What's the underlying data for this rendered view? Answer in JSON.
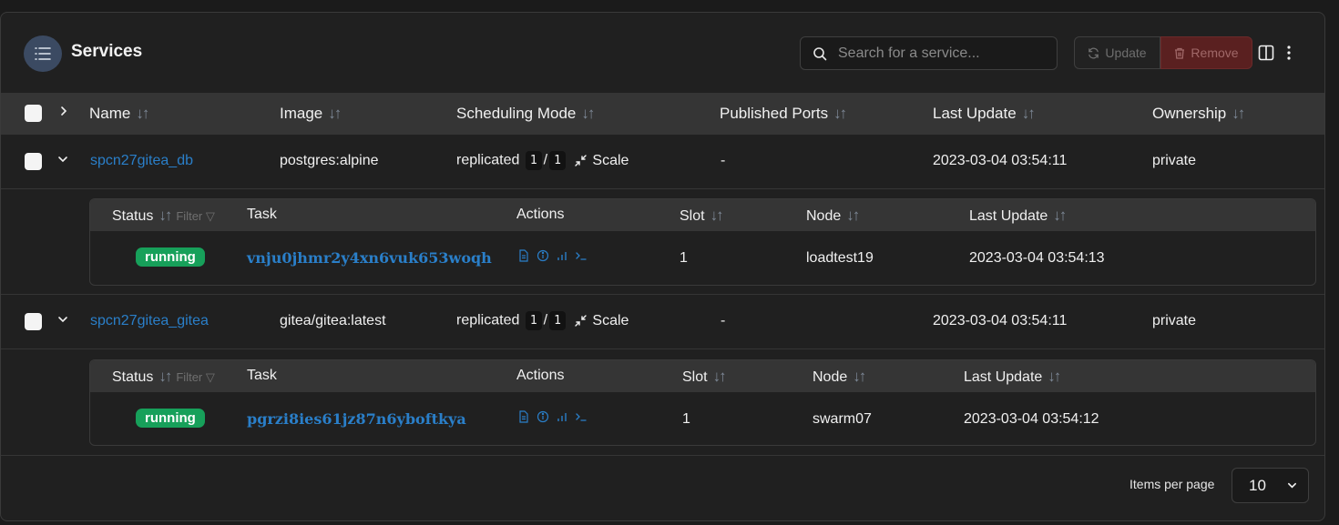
{
  "header": {
    "title": "Services",
    "search_placeholder": "Search for a service...",
    "update_label": "Update",
    "remove_label": "Remove"
  },
  "columns": {
    "name": "Name",
    "image": "Image",
    "scheduling": "Scheduling Mode",
    "ports": "Published Ports",
    "last_update": "Last Update",
    "ownership": "Ownership"
  },
  "services": [
    {
      "name": "spcn27gitea_db",
      "image": "postgres:alpine",
      "mode": "replicated",
      "running": "1",
      "sep": "/",
      "desired": "1",
      "scale_label": "Scale",
      "ports": "-",
      "last_update": "2023-03-04 03:54:11",
      "ownership": "private",
      "tasks_header": {
        "status": "Status",
        "filter": "Filter",
        "task": "Task",
        "actions": "Actions",
        "slot": "Slot",
        "node": "Node",
        "last_update": "Last Update"
      },
      "task": {
        "status": "running",
        "id": "vnju0jhmr2y4xn6vuk653woqh",
        "slot": "1",
        "node": "loadtest19",
        "last_update": "2023-03-04 03:54:13"
      }
    },
    {
      "name": "spcn27gitea_gitea",
      "image": "gitea/gitea:latest",
      "mode": "replicated",
      "running": "1",
      "sep": "/",
      "desired": "1",
      "scale_label": "Scale",
      "ports": "-",
      "last_update": "2023-03-04 03:54:11",
      "ownership": "private",
      "tasks_header": {
        "status": "Status",
        "filter": "Filter",
        "task": "Task",
        "actions": "Actions",
        "slot": "Slot",
        "node": "Node",
        "last_update": "Last Update"
      },
      "task": {
        "status": "running",
        "id": "pgrzi8ies61jz87n6yboftkya",
        "slot": "1",
        "node": "swarm07",
        "last_update": "2023-03-04 03:54:12"
      }
    }
  ],
  "footer": {
    "items_per_page_label": "Items per page",
    "items_per_page_value": "10"
  },
  "colors": {
    "accent_link": "#2a7fc9",
    "running_badge": "#17a05a",
    "remove_button": "#5a2020"
  }
}
